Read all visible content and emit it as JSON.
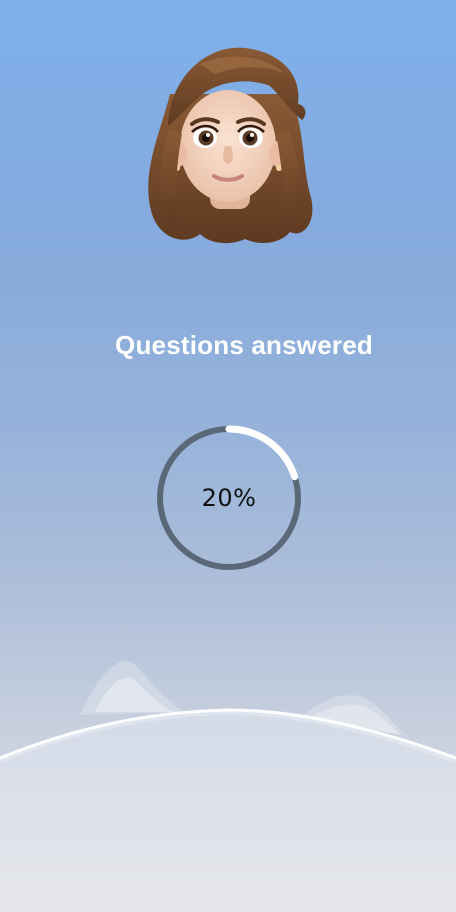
{
  "screen": {
    "title": "Questions answered"
  },
  "avatar": {
    "icon": "memoji-avatar-icon"
  },
  "progress": {
    "label": "20%",
    "fraction": 0.2,
    "track_color": "#5b6878",
    "fill_color": "#ffffff"
  }
}
